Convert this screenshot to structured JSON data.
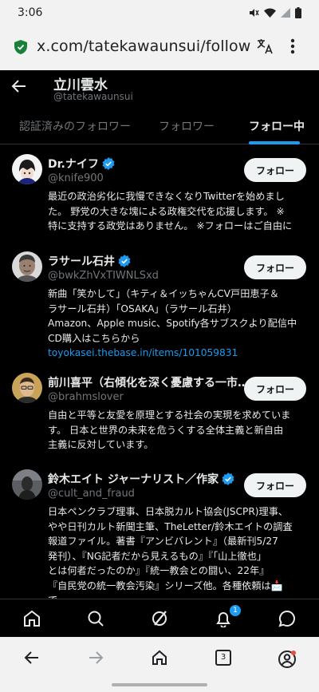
{
  "status_bar": {
    "time": "3:06"
  },
  "browser": {
    "url": "x.com/tatekawaunsui/following"
  },
  "header": {
    "name": "立川雲水",
    "handle": "@tatekawaunsui"
  },
  "tabs": [
    {
      "label": "認証済みのフォロワー",
      "active": false
    },
    {
      "label": "フォロワー",
      "active": false
    },
    {
      "label": "フォロー中",
      "active": true
    }
  ],
  "users": [
    {
      "name": "Dr.ナイフ",
      "handle": "@knife900",
      "verified": true,
      "button": "フォロー",
      "bio_lines": [
        "最近の政治劣化に我慢できなくなりTwitterを始めまし",
        "た。 野党の大きな塊による政権交代を応援します。 ※",
        "特に支持する政党はありません。 ※フォローはご自由に"
      ]
    },
    {
      "name": "ラサール石井",
      "handle": "@bwkZhVxTIWNLSxd",
      "verified": true,
      "button": "フォロー",
      "bio_lines": [
        "新曲「笑かして」（キティ＆イッちゃんCV戸田恵子＆",
        "ラサール石井）「OSAKA」（ラサール石井）",
        "Amazon、Apple music、Spotify各サブスクより配信中",
        "CD購入はこちらから"
      ],
      "bio_link": "toyokasei.thebase.in/items/101059831"
    },
    {
      "name": "前川喜平（右傾化を深く憂慮する一市…",
      "handle": "@brahmslover",
      "verified": false,
      "button": "フォロー",
      "bio_lines": [
        "自由と平等と友愛を原理とする社会の実現を求めていま",
        "す。 日本と世界の未来を危うくする全体主義と新自由",
        "主義に反対しています。"
      ]
    },
    {
      "name": "鈴木エイト ジャーナリスト／作家",
      "handle": "@cult_and_fraud",
      "verified": true,
      "button": "フォロー",
      "bio_lines": [
        "日本ペンクラブ理事、日本脱カルト協会(JSCPR)理事、",
        "やや日刊カルト新聞主筆、TheLetter/鈴木エイトの調査",
        "報道ファイル。著書『アンビバレント』（最新刊5/27",
        "発刊）、『NG記者だから見えるもの』『「山上徹也」",
        "とは何者だったのか』『統一教会との闘い、22年』",
        "『自民党の統一教会汚染』シリーズ他。各種依頼は📩",
        "で"
      ]
    }
  ],
  "bottom_nav": {
    "items": [
      "home-icon",
      "search-icon",
      "grok-icon",
      "notifications-icon",
      "messages-icon"
    ],
    "notification_badge": "1"
  },
  "chrome_toolbar": {
    "tab_count": "3"
  },
  "colors": {
    "accent": "#1d9bf0",
    "background": "#000000",
    "text": "#e7e9ea",
    "muted": "#71767b"
  }
}
